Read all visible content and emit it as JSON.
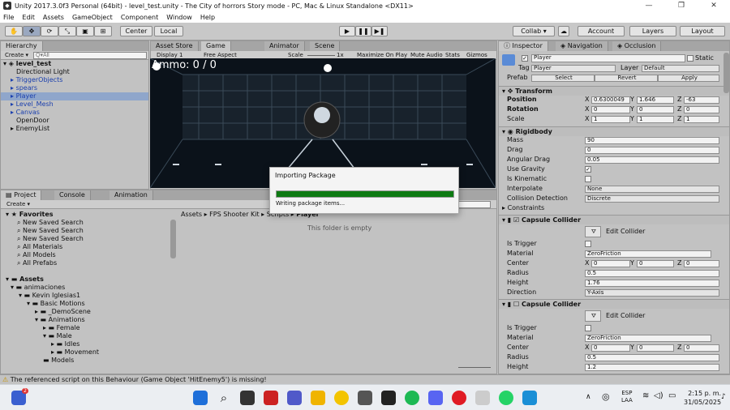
{
  "window": {
    "title": "Unity 2017.3.0f3 Personal (64bit) - level_test.unity - The City of horrors Story mode - PC, Mac & Linux Standalone <DX11>",
    "controls": [
      "—",
      "❐",
      "✕"
    ]
  },
  "menu": [
    "File",
    "Edit",
    "Assets",
    "GameObject",
    "Component",
    "Window",
    "Help"
  ],
  "toolbar": {
    "pivot": "Center",
    "space": "Local",
    "collab": "Collab ▾",
    "account": "Account",
    "layers": "Layers",
    "layout": "Layout"
  },
  "hierarchy": {
    "tab": "Hierarchy",
    "create": "Create ▾",
    "search_placeholder": "Q▾All",
    "scene": "level_test",
    "items": [
      "Directional Light",
      "TriggerObjects",
      "spears",
      "Player",
      "Level_Mesh",
      "Canvas",
      "OpenDoor",
      "EnemyList"
    ]
  },
  "scene_tabs": [
    "Asset Store",
    "Game",
    "Animator",
    "Scene"
  ],
  "game": {
    "display": "Display 1",
    "aspect": "Free Aspect",
    "scale_label": "Scale",
    "scale_value": "1x",
    "buttons": [
      "Maximize On Play",
      "Mute Audio",
      "Stats",
      "Gizmos"
    ],
    "hud": "Ammo: 0 / 0"
  },
  "project": {
    "tabs": [
      "Project",
      "Console",
      "Animation"
    ],
    "create": "Create ▾",
    "favorites_title": "Favorites",
    "favorites": [
      "New Saved Search",
      "New Saved Search",
      "New Saved Search",
      "All Materials",
      "All Models",
      "All Prefabs"
    ],
    "assets_title": "Assets",
    "tree": [
      "animaciones",
      "Kevin Iglesias1",
      "Basic Motions",
      "_DemoScene",
      "Animations",
      "Female",
      "Male",
      "Idles",
      "Movement",
      "Models"
    ],
    "breadcrumb": [
      "Assets",
      "FPS Shooter Kit",
      "Scripts",
      "Player"
    ],
    "empty_text": "This folder is empty"
  },
  "inspector": {
    "tabs": [
      "Inspector",
      "Navigation",
      "Occlusion"
    ],
    "object_name": "Player",
    "static_label": "Static",
    "tag_label": "Tag",
    "tag_value": "Player",
    "layer_label": "Layer",
    "layer_value": "Default",
    "prefab_label": "Prefab",
    "prefab_buttons": [
      "Select",
      "Revert",
      "Apply"
    ],
    "transform": {
      "title": "Transform",
      "position_label": "Position",
      "position": [
        "0.6300049",
        "1.646",
        "-63"
      ],
      "rotation_label": "Rotation",
      "rotation": [
        "0",
        "0",
        "0"
      ],
      "scale_label": "Scale",
      "scale": [
        "1",
        "1",
        "1"
      ]
    },
    "rigidbody": {
      "title": "Rigidbody",
      "fields": [
        {
          "label": "Mass",
          "value": "90"
        },
        {
          "label": "Drag",
          "value": "0"
        },
        {
          "label": "Angular Drag",
          "value": "0.05"
        }
      ],
      "use_gravity_label": "Use Gravity",
      "use_gravity": "✓",
      "is_kinematic_label": "Is Kinematic",
      "interpolate_label": "Interpolate",
      "interpolate_value": "None",
      "collision_label": "Collision Detection",
      "collision_value": "Discrete",
      "constraints_label": "Constraints"
    },
    "capsule1": {
      "title": "Capsule Collider",
      "edit_label": "Edit Collider",
      "is_trigger_label": "Is Trigger",
      "material_label": "Material",
      "material_value": "ZeroFriction",
      "center_label": "Center",
      "center": [
        "0",
        "0",
        "0"
      ],
      "radius_label": "Radius",
      "radius": "0.5",
      "height_label": "Height",
      "height": "1.76",
      "direction_label": "Direction",
      "direction": "Y-Axis"
    },
    "capsule2": {
      "title": "Capsule Collider",
      "edit_label": "Edit Collider",
      "is_trigger_label": "Is Trigger",
      "material_label": "Material",
      "material_value": "ZeroFriction",
      "center_label": "Center",
      "center": [
        "0",
        "0",
        "0"
      ],
      "radius_label": "Radius",
      "radius": "0.5",
      "height_label": "Height",
      "height": "1.2"
    },
    "axis": [
      "X",
      "Y",
      "Z"
    ]
  },
  "dialog": {
    "title": "Importing Package",
    "progress": 1.0,
    "status": "Writing package items..."
  },
  "status_message": "The referenced script on this Behaviour (Game Object 'HitEnemy5') is missing!",
  "taskbar": {
    "lang": "ESP",
    "lang2": "LAA",
    "time": "2:15 p. m.",
    "date": "31/05/2025",
    "notification_count": "2"
  },
  "colors": {
    "selection": "#8fa6cb",
    "progress": "#0e7a13",
    "link_blue": "#1a3fae"
  }
}
